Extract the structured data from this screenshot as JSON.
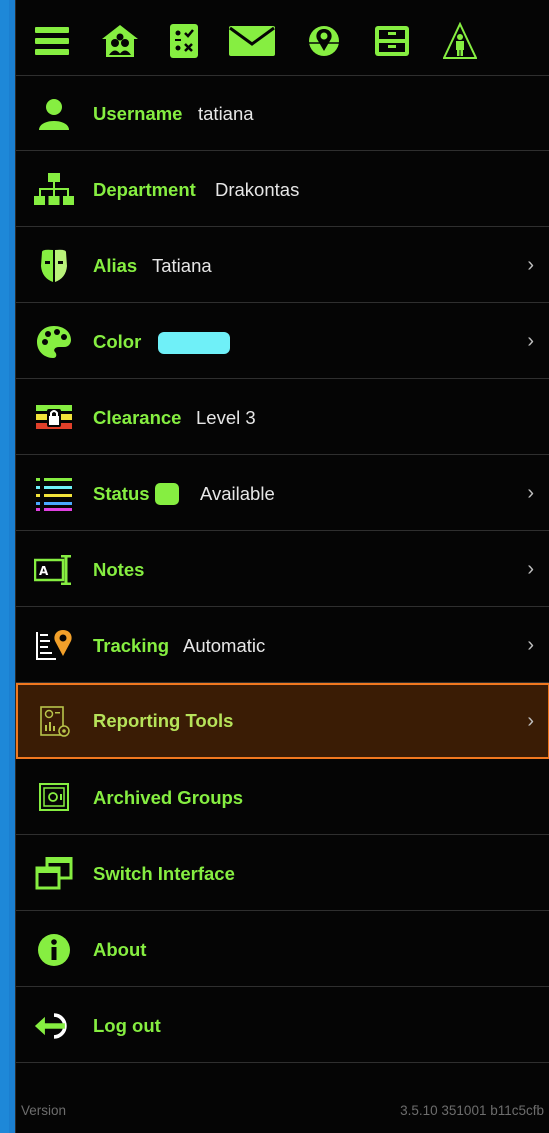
{
  "colors": {
    "accent_green": "#86ee41",
    "selected_bg": "#3a1c05",
    "selected_border": "#f07820",
    "user_color": "#6ff0f8",
    "status_color": "#86ee41"
  },
  "toolbar": {
    "icons": [
      "menu-icon",
      "group-home-icon",
      "checklist-icon",
      "mail-icon",
      "map-pin-icon",
      "cabinet-icon",
      "person-triangle-icon"
    ]
  },
  "menu": {
    "username": {
      "label": "Username",
      "value": "tatiana",
      "icon": "user-icon"
    },
    "department": {
      "label": "Department",
      "value": "Drakontas",
      "icon": "org-chart-icon"
    },
    "alias": {
      "label": "Alias",
      "value": "Tatiana",
      "icon": "mask-icon"
    },
    "color": {
      "label": "Color",
      "icon": "palette-icon"
    },
    "clearance": {
      "label": "Clearance",
      "value": "Level 3",
      "icon": "lock-stripes-icon"
    },
    "status": {
      "label": "Status",
      "value": "Available",
      "icon": "list-icon"
    },
    "notes": {
      "label": "Notes",
      "icon": "text-cursor-icon"
    },
    "tracking": {
      "label": "Tracking",
      "value": "Automatic",
      "icon": "location-pin-icon"
    },
    "reporting": {
      "label": "Reporting Tools",
      "icon": "report-icon"
    },
    "archived": {
      "label": "Archived Groups",
      "icon": "safe-icon"
    },
    "switch": {
      "label": "Switch Interface",
      "icon": "windows-icon"
    },
    "about": {
      "label": "About",
      "icon": "info-icon"
    },
    "logout": {
      "label": "Log out",
      "icon": "logout-icon"
    },
    "chevron": "›"
  },
  "footer": {
    "version_label": "Version",
    "version_number": "3.5.10 351001 b11c5cfb"
  }
}
